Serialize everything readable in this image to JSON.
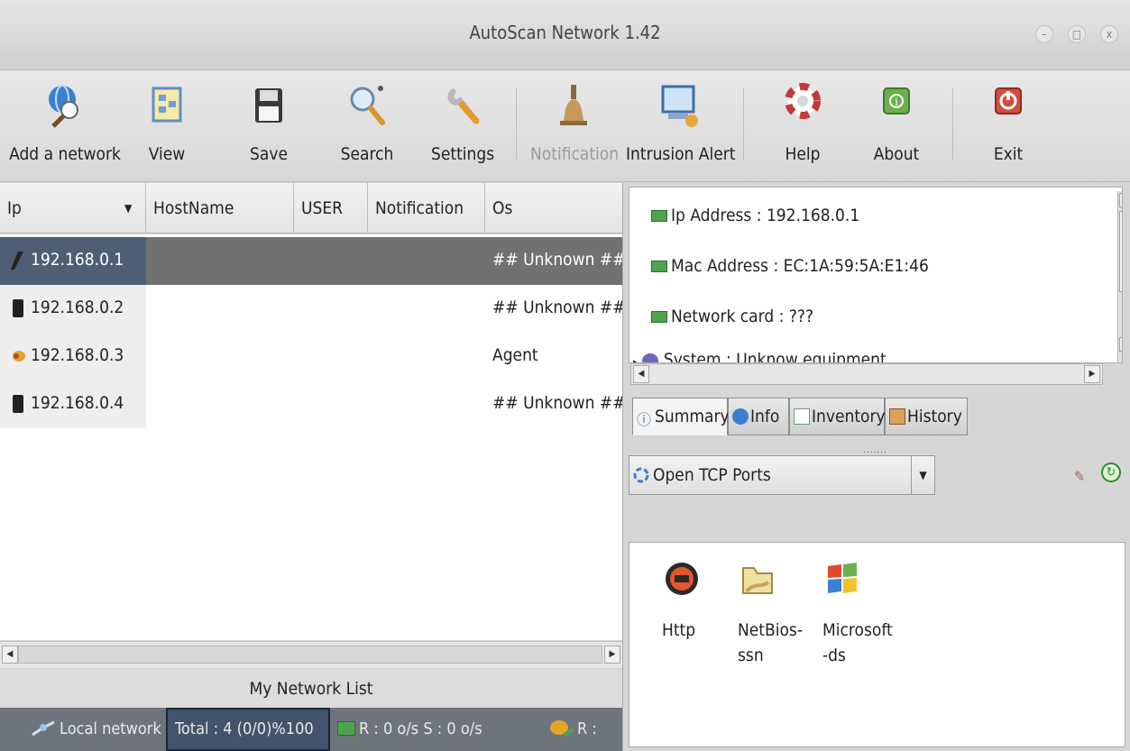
{
  "window": {
    "title": "AutoScan Network 1.42",
    "controls": [
      "–",
      "□",
      "x"
    ]
  },
  "toolbar": {
    "add_network": "Add a network",
    "view": "View",
    "save": "Save",
    "search": "Search",
    "settings": "Settings",
    "notification": "Notification",
    "intrusion_alert": "Intrusion Alert",
    "help": "Help",
    "about": "About",
    "exit": "Exit"
  },
  "table": {
    "columns": [
      "Ip",
      "HostName",
      "USER",
      "Notification",
      "Os"
    ],
    "rows": [
      {
        "ip": "192.168.0.1",
        "os": "## Unknown ##",
        "icon": "router-icon",
        "selected": true
      },
      {
        "ip": "192.168.0.2",
        "os": "## Unknown ##",
        "icon": "device-icon",
        "selected": false
      },
      {
        "ip": "192.168.0.3",
        "os": "Agent",
        "icon": "agent-icon",
        "selected": false
      },
      {
        "ip": "192.168.0.4",
        "os": "## Unknown ##",
        "icon": "device-icon",
        "selected": false
      }
    ]
  },
  "network_list_label": "My Network List",
  "status": {
    "local": "Local network",
    "total": "Total : 4  (0/0)%100",
    "traffic": "R : 0 o/s S : 0 o/s",
    "r2": "R :"
  },
  "details": {
    "ip_address": "Ip Address : 192.168.0.1",
    "mac_address": "Mac Address : EC:1A:59:5A:E1:46",
    "network_card": "Network card : ???",
    "system": "System : Unknow equipment"
  },
  "tabs": [
    "Summary",
    "Info",
    "Inventory",
    "History"
  ],
  "ports": {
    "selector": "Open TCP Ports",
    "items": [
      {
        "label": "Http",
        "icon": "http-icon"
      },
      {
        "label": "NetBios-ssn",
        "icon": "folder-icon"
      },
      {
        "label": "Microsoft-ds",
        "icon": "windows-icon"
      }
    ]
  },
  "colors": {
    "selection_ip": "#4e5e74",
    "selection_row": "#717171",
    "status_bar": "#6e747c"
  }
}
